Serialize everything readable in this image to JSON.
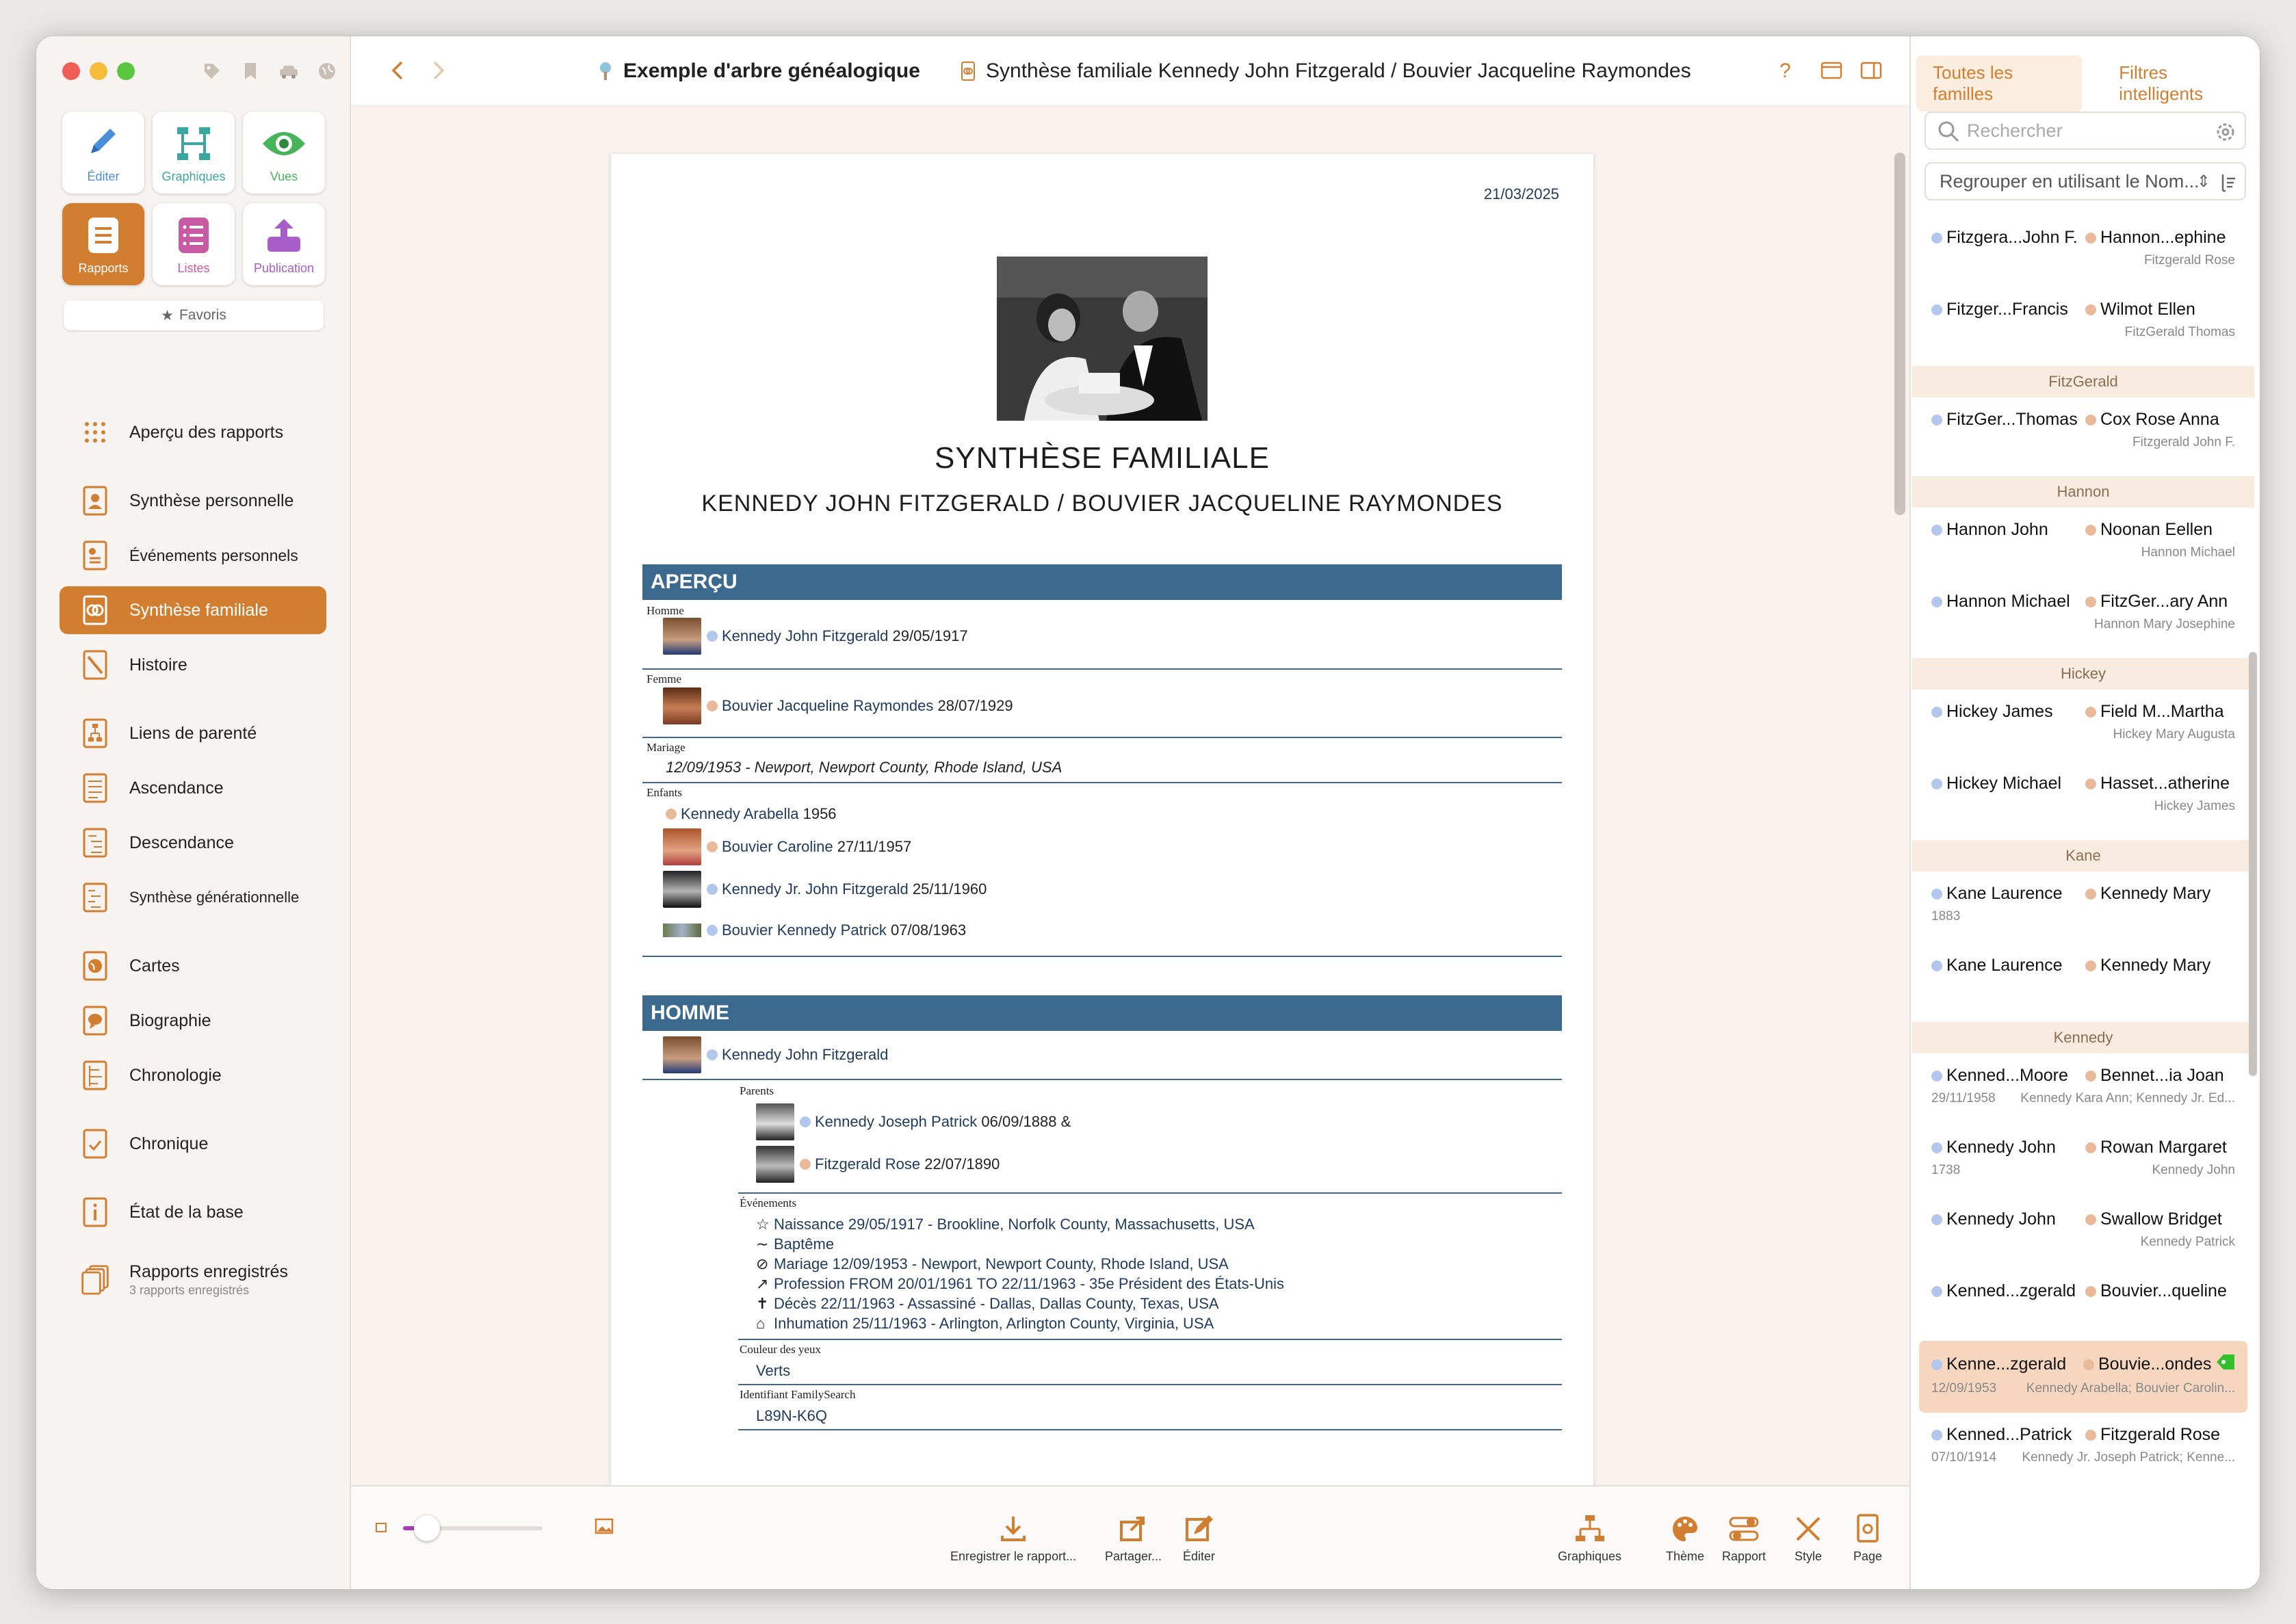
{
  "sidebar": {
    "modules": [
      {
        "label": "Éditer",
        "icon": "pencil-icon"
      },
      {
        "label": "Graphiques",
        "icon": "tree-chart-icon"
      },
      {
        "label": "Vues",
        "icon": "eye-icon"
      },
      {
        "label": "Rapports",
        "icon": "report-icon"
      },
      {
        "label": "Listes",
        "icon": "list-icon"
      },
      {
        "label": "Publication",
        "icon": "upload-icon"
      }
    ],
    "favorites": "Favoris",
    "items": [
      {
        "label": "Aperçu des rapports"
      },
      {
        "label": "Synthèse personnelle"
      },
      {
        "label": "Événements personnels"
      },
      {
        "label": "Synthèse familiale"
      },
      {
        "label": "Histoire"
      },
      {
        "label": "Liens de parenté"
      },
      {
        "label": "Ascendance"
      },
      {
        "label": "Descendance"
      },
      {
        "label": "Synthèse générationnelle"
      },
      {
        "label": "Cartes"
      },
      {
        "label": "Biographie"
      },
      {
        "label": "Chronologie"
      },
      {
        "label": "Chronique"
      },
      {
        "label": "État de la base"
      },
      {
        "label": "Rapports enregistrés",
        "sub": "3 rapports enregistrés"
      }
    ]
  },
  "toolbar": {
    "db_title": "Exemple d'arbre généalogique",
    "doc_title": "Synthèse familiale Kennedy John Fitzgerald / Bouvier Jacqueline Raymondes",
    "help": "?"
  },
  "report": {
    "date": "21/03/2025",
    "title": "SYNTHÈSE FAMILIALE",
    "subtitle": "KENNEDY JOHN FITZGERALD / BOUVIER JACQUELINE RAYMONDES",
    "apercu_header": "APERÇU",
    "homme_label": "Homme",
    "homme_name": "Kennedy John Fitzgerald",
    "homme_date": "29/05/1917",
    "femme_label": "Femme",
    "femme_name": "Bouvier Jacqueline Raymondes",
    "femme_date": "28/07/1929",
    "mariage_label": "Mariage",
    "mariage_text": "12/09/1953 - Newport, Newport County, Rhode Island, USA",
    "enfants_label": "Enfants",
    "children": [
      {
        "name": "Kennedy Arabella",
        "date": "1956"
      },
      {
        "name": "Bouvier Caroline",
        "date": "27/11/1957"
      },
      {
        "name": "Kennedy Jr. John Fitzgerald",
        "date": "25/11/1960"
      },
      {
        "name": "Bouvier Kennedy Patrick",
        "date": "07/08/1963"
      }
    ],
    "homme_header": "HOMME",
    "homme_full": "Kennedy John Fitzgerald",
    "parents_label": "Parents",
    "father_name": "Kennedy Joseph Patrick",
    "father_date": "06/09/1888 &",
    "mother_name": "Fitzgerald Rose",
    "mother_date": "22/07/1890",
    "events_label": "Événements",
    "events": [
      {
        "icon": "star-icon",
        "text": "Naissance 29/05/1917 - Brookline, Norfolk County, Massachusetts, USA"
      },
      {
        "icon": "wave-icon",
        "text": "Baptême"
      },
      {
        "icon": "rings-icon",
        "text": "Mariage 12/09/1953 - Newport, Newport County, Rhode Island, USA"
      },
      {
        "icon": "hammer-icon",
        "text": "Profession FROM 20/01/1961 TO 22/11/1963 - 35e Président des États-Unis"
      },
      {
        "icon": "cross-icon",
        "text": "Décès 22/11/1963 - Assassiné - Dallas, Dallas County, Texas, USA"
      },
      {
        "icon": "grave-icon",
        "text": "Inhumation 25/11/1963 - Arlington, Arlington County, Virginia, USA"
      }
    ],
    "eyes_label": "Couleur des yeux",
    "eyes_value": "Verts",
    "fs_label": "Identifiant FamilySearch",
    "fs_value": "L89N-K6Q"
  },
  "bottombar": {
    "save": "Enregistrer le rapport...",
    "share": "Partager...",
    "edit": "Éditer",
    "charts": "Graphiques",
    "theme": "Thème",
    "report": "Rapport",
    "style": "Style",
    "page": "Page",
    "zoom": 0.1
  },
  "rpanel": {
    "tab_all": "Toutes les familles",
    "tab_smart": "Filtres intelligents",
    "search_placeholder": "Rechercher",
    "group_by": "Regrouper en utilisant le Nom...",
    "families": [
      {
        "group": "",
        "m": "Fitzgera...John F.",
        "f": "Hannon...ephine",
        "left": "",
        "right": "Fitzgerald Rose"
      },
      {
        "group": "",
        "m": "Fitzger...Francis",
        "f": "Wilmot Ellen",
        "left": "",
        "right": "FitzGerald Thomas"
      },
      {
        "group": "FitzGerald",
        "m": "FitzGer...Thomas",
        "f": "Cox Rose Anna",
        "left": "",
        "right": "Fitzgerald John F."
      },
      {
        "group": "Hannon",
        "m": "Hannon John",
        "f": "Noonan Eellen",
        "left": "",
        "right": "Hannon Michael"
      },
      {
        "group": "",
        "m": "Hannon Michael",
        "f": "FitzGer...ary Ann",
        "left": "",
        "right": "Hannon Mary Josephine"
      },
      {
        "group": "Hickey",
        "m": "Hickey James",
        "f": "Field M...Martha",
        "left": "",
        "right": "Hickey Mary Augusta"
      },
      {
        "group": "",
        "m": "Hickey Michael",
        "f": "Hasset...atherine",
        "left": "",
        "right": "Hickey James"
      },
      {
        "group": "Kane",
        "m": "Kane Laurence",
        "f": "Kennedy Mary",
        "left": "1883",
        "right": ""
      },
      {
        "group": "",
        "m": "Kane Laurence",
        "f": "Kennedy Mary",
        "left": "",
        "right": ""
      },
      {
        "group": "Kennedy",
        "m": "Kenned...Moore",
        "f": "Bennet...ia Joan",
        "left": "29/11/1958",
        "right": "Kennedy Kara Ann; Kennedy Jr. Ed..."
      },
      {
        "group": "",
        "m": "Kennedy John",
        "f": "Rowan Margaret",
        "left": "1738",
        "right": "Kennedy John"
      },
      {
        "group": "",
        "m": "Kennedy John",
        "f": "Swallow Bridget",
        "left": "",
        "right": "Kennedy Patrick"
      },
      {
        "group": "",
        "m": "Kenned...zgerald",
        "f": "Bouvier...queline",
        "left": "",
        "right": ""
      },
      {
        "group": "",
        "m": "Kenne...zgerald",
        "f": "Bouvie...ondes",
        "left": "12/09/1953",
        "right": "Kennedy Arabella; Bouvier Carolin...",
        "selected": true
      },
      {
        "group": "",
        "m": "Kenned...Patrick",
        "f": "Fitzgerald Rose",
        "left": "07/10/1914",
        "right": "Kennedy Jr. Joseph Patrick; Kenne..."
      }
    ]
  }
}
